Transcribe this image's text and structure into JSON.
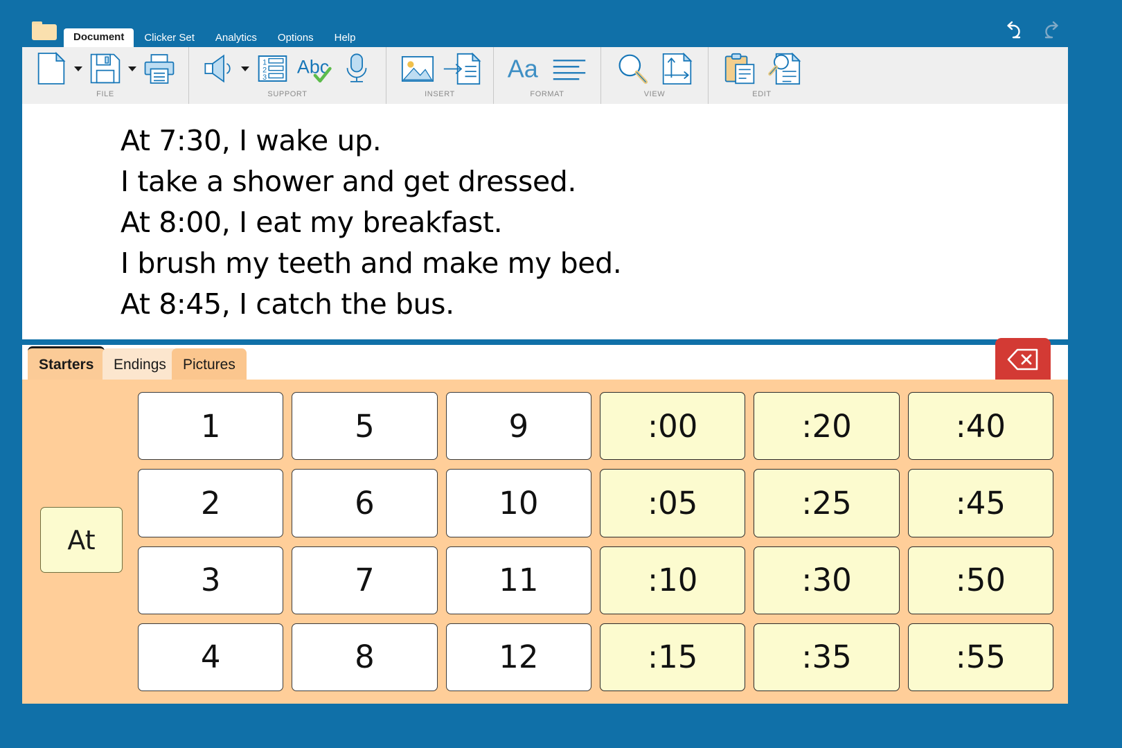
{
  "app": {
    "folder_icon": "folder-icon",
    "accent_color": "#1070A8",
    "panel_color": "#FFCE99",
    "key_color": "#FCFBCF"
  },
  "menubar": {
    "items": [
      {
        "label": "Document",
        "active": true
      },
      {
        "label": "Clicker Set",
        "active": false
      },
      {
        "label": "Analytics",
        "active": false
      },
      {
        "label": "Options",
        "active": false
      },
      {
        "label": "Help",
        "active": false
      }
    ],
    "undo": {
      "name": "undo-icon",
      "enabled": true
    },
    "redo": {
      "name": "redo-icon",
      "enabled": false
    }
  },
  "ribbon": {
    "groups": [
      {
        "label": "FILE",
        "buttons": [
          {
            "name": "new-document-icon",
            "caret": true
          },
          {
            "name": "save-document-icon",
            "caret": true
          },
          {
            "name": "print-icon",
            "caret": false
          }
        ]
      },
      {
        "label": "SUPPORT",
        "buttons": [
          {
            "name": "speaker-icon",
            "caret": true
          },
          {
            "name": "numbered-list-icon",
            "caret": false
          },
          {
            "name": "spellcheck-abc-icon",
            "caret": false
          },
          {
            "name": "microphone-icon",
            "caret": false
          }
        ]
      },
      {
        "label": "INSERT",
        "buttons": [
          {
            "name": "insert-picture-icon",
            "caret": false
          },
          {
            "name": "insert-page-icon",
            "caret": false
          }
        ]
      },
      {
        "label": "FORMAT",
        "buttons": [
          {
            "name": "font-size-aa-icon",
            "caret": false
          },
          {
            "name": "paragraph-align-icon",
            "caret": false
          }
        ]
      },
      {
        "label": "VIEW",
        "buttons": [
          {
            "name": "zoom-magnifier-icon",
            "caret": false
          },
          {
            "name": "page-layout-icon",
            "caret": false
          }
        ]
      },
      {
        "label": "EDIT",
        "buttons": [
          {
            "name": "paste-clipboard-icon",
            "caret": false
          },
          {
            "name": "find-in-document-icon",
            "caret": false
          }
        ]
      }
    ]
  },
  "document": {
    "lines": [
      "At 7:30, I wake up.",
      "I take a shower and get dressed.",
      "At 8:00, I eat my breakfast.",
      "I brush my teeth and make my bed.",
      "At 8:45, I catch the bus."
    ]
  },
  "grid_tabs": [
    {
      "label": "Starters",
      "state": "selected"
    },
    {
      "label": "Endings",
      "state": "alt"
    },
    {
      "label": "Pictures",
      "state": "plain"
    }
  ],
  "backspace": {
    "name": "backspace-icon",
    "color": "#D33A34"
  },
  "word_grid": {
    "anchor": "At",
    "cells": [
      {
        "label": "1",
        "kind": "number"
      },
      {
        "label": "5",
        "kind": "number"
      },
      {
        "label": "9",
        "kind": "number"
      },
      {
        "label": ":00",
        "kind": "time"
      },
      {
        "label": ":20",
        "kind": "time"
      },
      {
        "label": ":40",
        "kind": "time"
      },
      {
        "label": "2",
        "kind": "number"
      },
      {
        "label": "6",
        "kind": "number"
      },
      {
        "label": "10",
        "kind": "number"
      },
      {
        "label": ":05",
        "kind": "time"
      },
      {
        "label": ":25",
        "kind": "time"
      },
      {
        "label": ":45",
        "kind": "time"
      },
      {
        "label": "3",
        "kind": "number"
      },
      {
        "label": "7",
        "kind": "number"
      },
      {
        "label": "11",
        "kind": "number"
      },
      {
        "label": ":10",
        "kind": "time"
      },
      {
        "label": ":30",
        "kind": "time"
      },
      {
        "label": ":50",
        "kind": "time"
      },
      {
        "label": "4",
        "kind": "number"
      },
      {
        "label": "8",
        "kind": "number"
      },
      {
        "label": "12",
        "kind": "number"
      },
      {
        "label": ":15",
        "kind": "time"
      },
      {
        "label": ":35",
        "kind": "time"
      },
      {
        "label": ":55",
        "kind": "time"
      }
    ]
  }
}
